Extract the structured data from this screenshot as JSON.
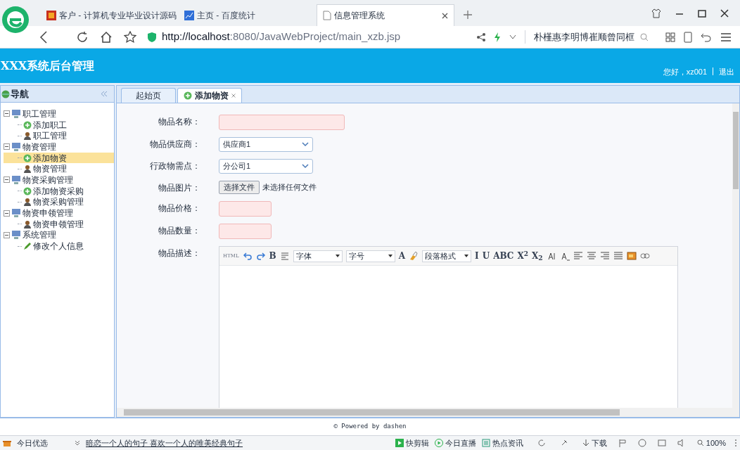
{
  "browser": {
    "tabs": [
      {
        "title": "客户 - 计算机专业毕业设计源码",
        "selected": false
      },
      {
        "title": "主页 - 百度统计",
        "selected": false
      },
      {
        "title": "信息管理系统",
        "selected": true
      }
    ],
    "url_host": "http://localhost",
    "url_rest": ":8080/JavaWebProject/main_xzb.jsp",
    "search_text": "朴槿惠李明博崔顺曾同框"
  },
  "header": {
    "title": "XXX系统后台管理",
    "greeting": "您好，xz001",
    "logout": "退出"
  },
  "nav": {
    "title": "导航",
    "tree": [
      {
        "label": "职工管理",
        "expanded": true,
        "children": [
          {
            "label": "添加职工",
            "kind": "add",
            "selected": false
          },
          {
            "label": "职工管理",
            "kind": "user",
            "selected": false
          }
        ]
      },
      {
        "label": "物资管理",
        "expanded": true,
        "children": [
          {
            "label": "添加物资",
            "kind": "add",
            "selected": true
          },
          {
            "label": "物资管理",
            "kind": "user",
            "selected": false
          }
        ]
      },
      {
        "label": "物资采购管理",
        "expanded": true,
        "children": [
          {
            "label": "添加物资采购",
            "kind": "add",
            "selected": false
          },
          {
            "label": "物资采购管理",
            "kind": "user",
            "selected": false
          }
        ]
      },
      {
        "label": "物资申领管理",
        "expanded": true,
        "children": [
          {
            "label": "物资申领管理",
            "kind": "user",
            "selected": false
          }
        ]
      },
      {
        "label": "系统管理",
        "expanded": true,
        "children": [
          {
            "label": "修改个人信息",
            "kind": "edit",
            "selected": false
          }
        ]
      }
    ]
  },
  "tabs": [
    {
      "label": "起始页",
      "selected": false,
      "closable": false
    },
    {
      "label": "添加物资",
      "selected": true,
      "closable": true
    }
  ],
  "form": [
    {
      "label": "物品名称：",
      "kind": "text",
      "wide": true
    },
    {
      "label": "物品供应商：",
      "kind": "select",
      "value": "供应商1"
    },
    {
      "label": "行政物需点：",
      "kind": "select",
      "value": "分公司1"
    },
    {
      "label": "物品图片：",
      "kind": "file",
      "button": "选择文件",
      "status": "未选择任何文件"
    },
    {
      "label": "物品价格：",
      "kind": "text",
      "wide": false
    },
    {
      "label": "物品数量：",
      "kind": "text",
      "wide": false
    },
    {
      "label": "物品描述：",
      "kind": "editor"
    }
  ],
  "editor_toolbar": [
    {
      "kind": "text",
      "label": "HTML"
    },
    {
      "kind": "text",
      "label": "B"
    },
    {
      "kind": "select",
      "label": "字体"
    },
    {
      "kind": "select",
      "label": "字号"
    },
    {
      "kind": "text",
      "label": "A"
    },
    {
      "kind": "select",
      "label": "段落格式"
    },
    {
      "kind": "text",
      "label": "I"
    },
    {
      "kind": "text",
      "label": "U"
    },
    {
      "kind": "text",
      "label": "ABC"
    },
    {
      "kind": "text",
      "label": "X$^{2}$"
    },
    {
      "kind": "text",
      "label": "X$_{2}$"
    }
  ],
  "footer": "© Powered by dashen",
  "status_bar": {
    "left": "今日优选",
    "news": "暗恋一个人的句子 喜欢一个人的唯美经典句子",
    "items": [
      "快剪辑",
      "今日直播",
      "热点资讯"
    ],
    "download": "下载",
    "zoom": "100%"
  }
}
